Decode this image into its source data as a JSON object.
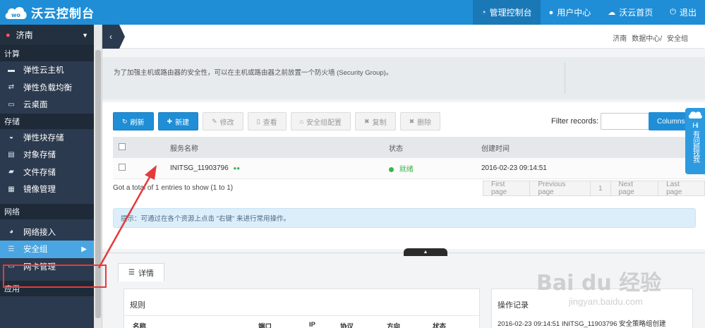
{
  "header": {
    "app_title": "沃云控制台",
    "nav": [
      {
        "label": "管理控制台",
        "icon": "dashboard-icon",
        "active": true
      },
      {
        "label": "用户中心",
        "icon": "user-icon"
      },
      {
        "label": "沃云首页",
        "icon": "cloud-icon"
      },
      {
        "label": "退出",
        "icon": "power-icon"
      }
    ]
  },
  "sidebar": {
    "region": "济南",
    "sections": [
      {
        "title": "计算",
        "items": [
          {
            "label": "弹性云主机",
            "icon": "server-icon"
          },
          {
            "label": "弹性负载均衡",
            "icon": "exchange-icon"
          },
          {
            "label": "云桌面",
            "icon": "desktop-icon"
          }
        ]
      },
      {
        "title": "存储",
        "items": [
          {
            "label": "弹性块存储",
            "icon": "drive-icon"
          },
          {
            "label": "对象存储",
            "icon": "storage-icon"
          },
          {
            "label": "文件存储",
            "icon": "folder-icon"
          },
          {
            "label": "镜像管理",
            "icon": "grid-icon"
          }
        ]
      },
      {
        "title": "网络",
        "items": [
          {
            "label": "网络接入",
            "icon": "globe-icon"
          },
          {
            "label": "安全组",
            "icon": "list-icon",
            "active": true
          },
          {
            "label": "网卡管理",
            "icon": "nic-icon"
          }
        ]
      },
      {
        "title": "应用",
        "items": []
      }
    ]
  },
  "breadcrumb": [
    "济南",
    "数据中心/",
    "安全组"
  ],
  "info_text": "为了加强主机或路由器的安全性，可以在主机或路由器之前放置一个防火墙 (Security Group)。",
  "toolbar": {
    "refresh": "刷新",
    "new": "新建",
    "edit": "修改",
    "view": "查看",
    "config": "安全组配置",
    "copy": "复制",
    "delete": "删除"
  },
  "filter": {
    "label": "Filter records:",
    "value": ""
  },
  "columns_label": "Columns",
  "table": {
    "headers": {
      "name": "服务名称",
      "status": "状态",
      "created": "创建时间"
    },
    "rows": [
      {
        "name": "INITSG_11903796",
        "status": "就绪",
        "created": "2016-02-23 09:14:51"
      }
    ]
  },
  "entries_text": "Got a total of 1 entries to show (1 to 1)",
  "pager": [
    "First page",
    "Previous page",
    "1",
    "Next page",
    "Last page"
  ],
  "tip": "提示：可通过在各个资源上点击 \"右键\" 来进行常用操作。",
  "details": {
    "tab_label": "详情",
    "rules_title": "规则",
    "rules_headers": [
      "名称",
      "端口",
      "IP",
      "协议",
      "方向",
      "状态"
    ],
    "log_title": "操作记录",
    "log_entry": "2016-02-23 09:14:51 INITSG_11903796 安全策略组创建"
  },
  "help_widget": {
    "title": "Hi",
    "text": "有问题找我"
  },
  "watermark": {
    "main": "Bai du 经验",
    "sub": "jingyan.baidu.com"
  },
  "colors": {
    "primary": "#1f8ed6",
    "sidebar": "#2b3a4e",
    "active": "#49a6e3",
    "annotation": "#e53a3a",
    "ready": "#39b54a"
  }
}
